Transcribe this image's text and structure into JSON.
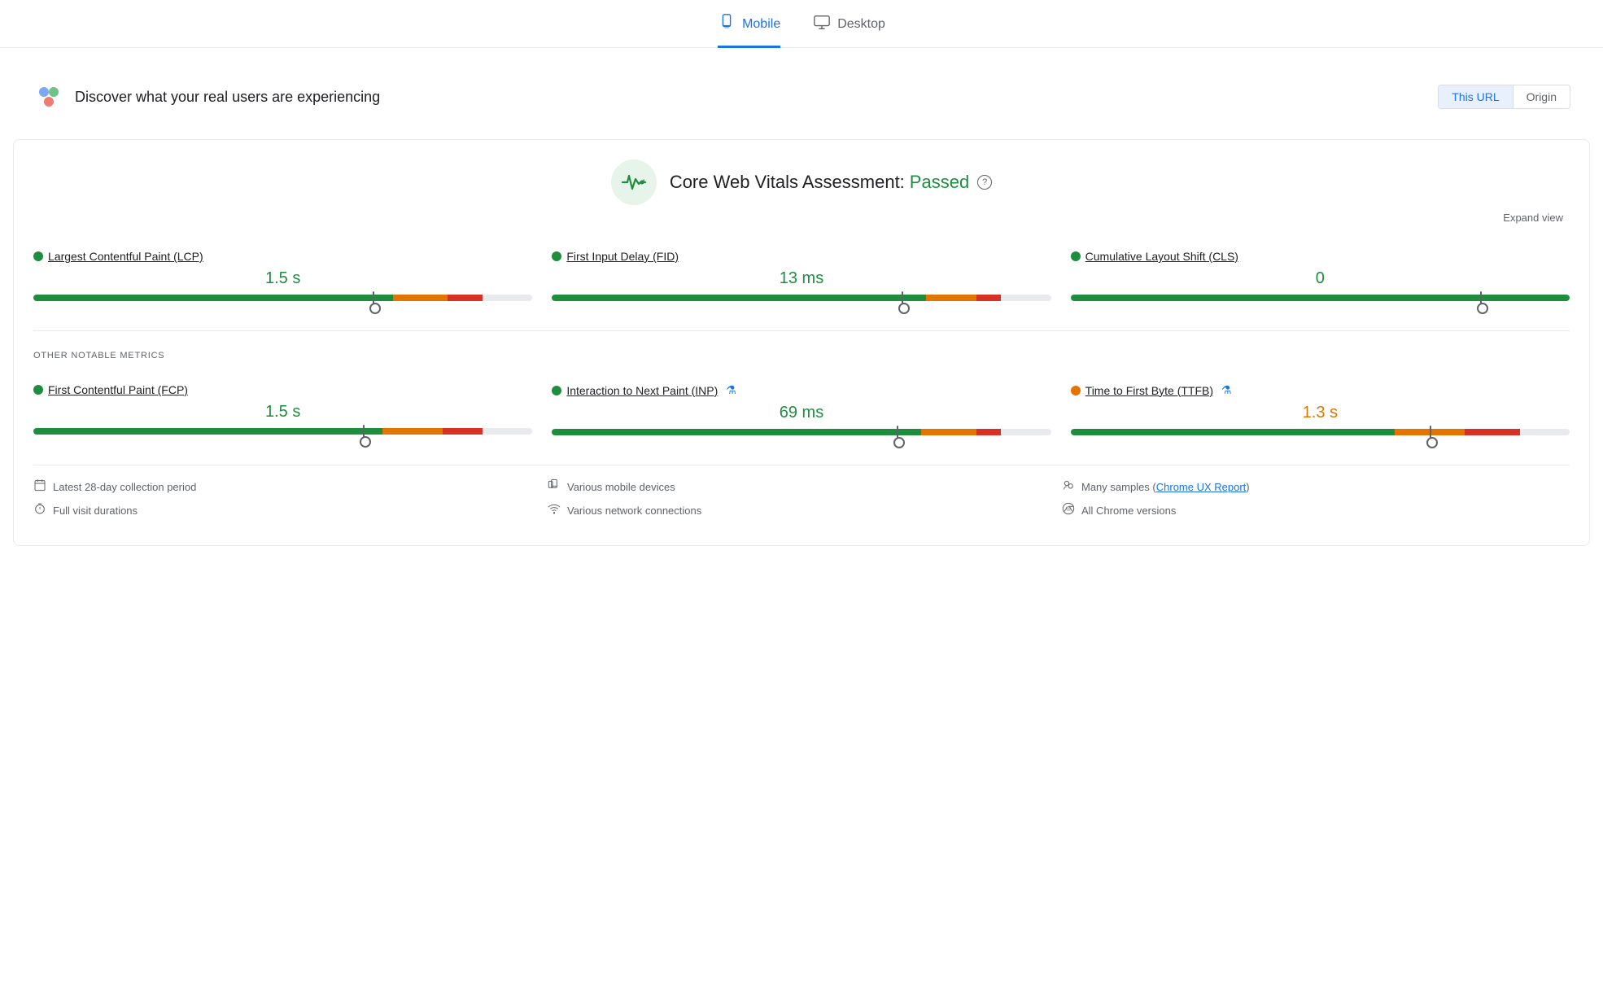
{
  "tabs": [
    {
      "id": "mobile",
      "label": "Mobile",
      "active": true
    },
    {
      "id": "desktop",
      "label": "Desktop",
      "active": false
    }
  ],
  "section": {
    "title": "Discover what your real users are experiencing",
    "url_buttons": [
      {
        "id": "this-url",
        "label": "This URL",
        "active": true
      },
      {
        "id": "origin",
        "label": "Origin",
        "active": false
      }
    ]
  },
  "cwv": {
    "assessment_label": "Core Web Vitals Assessment:",
    "status": "Passed",
    "expand_label": "Expand view"
  },
  "core_metrics": [
    {
      "id": "lcp",
      "dot_color": "green",
      "label": "Largest Contentful Paint (LCP)",
      "value": "1.5 s",
      "value_color": "green",
      "bar": {
        "green": 72,
        "orange": 11,
        "red": 7,
        "marker_pct": 68
      }
    },
    {
      "id": "fid",
      "dot_color": "green",
      "label": "First Input Delay (FID)",
      "value": "13 ms",
      "value_color": "green",
      "bar": {
        "green": 75,
        "orange": 10,
        "red": 5,
        "marker_pct": 70
      }
    },
    {
      "id": "cls",
      "dot_color": "green",
      "label": "Cumulative Layout Shift (CLS)",
      "value": "0",
      "value_color": "green",
      "bar": {
        "green": 100,
        "orange": 0,
        "red": 0,
        "marker_pct": 82
      }
    }
  ],
  "other_metrics_label": "OTHER NOTABLE METRICS",
  "other_metrics": [
    {
      "id": "fcp",
      "dot_color": "green",
      "label": "First Contentful Paint (FCP)",
      "value": "1.5 s",
      "value_color": "green",
      "has_flask": false,
      "bar": {
        "green": 70,
        "orange": 12,
        "red": 8,
        "marker_pct": 66
      }
    },
    {
      "id": "inp",
      "dot_color": "green",
      "label": "Interaction to Next Paint (INP)",
      "value": "69 ms",
      "value_color": "green",
      "has_flask": true,
      "bar": {
        "green": 74,
        "orange": 11,
        "red": 5,
        "marker_pct": 69
      }
    },
    {
      "id": "ttfb",
      "dot_color": "orange",
      "label": "Time to First Byte (TTFB)",
      "value": "1.3 s",
      "value_color": "orange",
      "has_flask": true,
      "bar": {
        "green": 65,
        "orange": 14,
        "red": 11,
        "marker_pct": 72
      }
    }
  ],
  "footer": {
    "col1": [
      {
        "icon": "📅",
        "text": "Latest 28-day collection period"
      },
      {
        "icon": "⏱",
        "text": "Full visit durations"
      }
    ],
    "col2": [
      {
        "icon": "📱",
        "text": "Various mobile devices"
      },
      {
        "icon": "📶",
        "text": "Various network connections"
      }
    ],
    "col3": [
      {
        "icon": "👥",
        "text": "Many samples",
        "link_text": "Chrome UX Report",
        "link": true
      },
      {
        "icon": "🌐",
        "text": "All Chrome versions"
      }
    ]
  }
}
